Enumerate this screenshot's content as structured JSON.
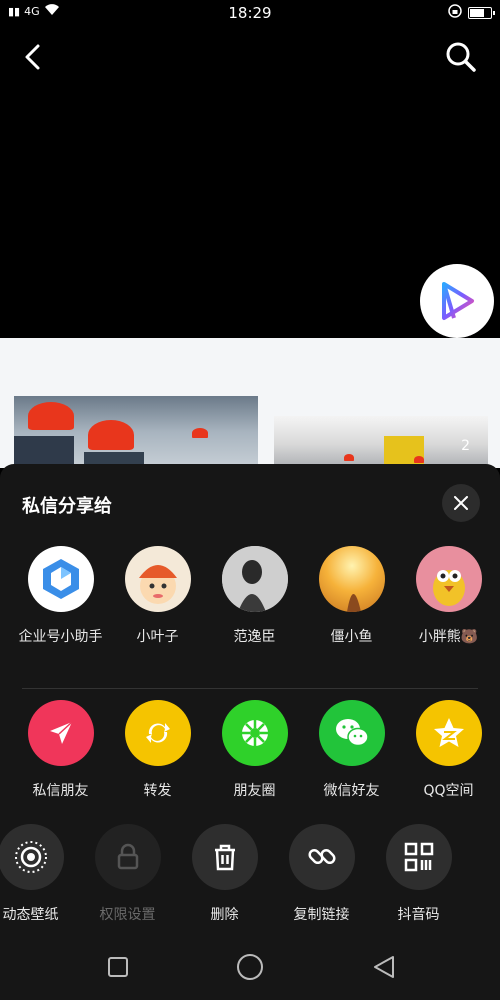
{
  "status_bar": {
    "signal": "4G",
    "time": "18:29"
  },
  "video": {
    "icons": [
      "back-icon",
      "search-icon",
      "app-logo-icon"
    ]
  },
  "content": {
    "image_count": "2"
  },
  "share_sheet": {
    "title": "私信分享给",
    "contacts": [
      {
        "name": "企业号小助手",
        "icon": "enterprise-assistant-avatar"
      },
      {
        "name": "小叶子",
        "icon": "cartoon-avatar"
      },
      {
        "name": "范逸臣",
        "icon": "photo-avatar"
      },
      {
        "name": "僵小鱼",
        "icon": "sunset-avatar"
      },
      {
        "name": "小胖熊🐻",
        "icon": "cartoon-bird-avatar"
      }
    ],
    "share_targets": [
      {
        "label": "私信朋友",
        "icon": "paper-plane-icon",
        "color": "#f0365a"
      },
      {
        "label": "转发",
        "icon": "repost-icon",
        "color": "#f5c400"
      },
      {
        "label": "朋友圈",
        "icon": "moments-icon",
        "color": "#2fd12a"
      },
      {
        "label": "微信好友",
        "icon": "wechat-icon",
        "color": "#22c43a"
      },
      {
        "label": "QQ空间",
        "icon": "qzone-icon",
        "color": "#f5c400"
      }
    ],
    "actions": [
      {
        "label": "动态壁纸",
        "icon": "live-wallpaper-icon",
        "enabled": true
      },
      {
        "label": "权限设置",
        "icon": "lock-icon",
        "enabled": false
      },
      {
        "label": "删除",
        "icon": "trash-icon",
        "enabled": true
      },
      {
        "label": "复制链接",
        "icon": "link-icon",
        "enabled": true
      },
      {
        "label": "抖音码",
        "icon": "qr-code-icon",
        "enabled": true
      }
    ]
  }
}
